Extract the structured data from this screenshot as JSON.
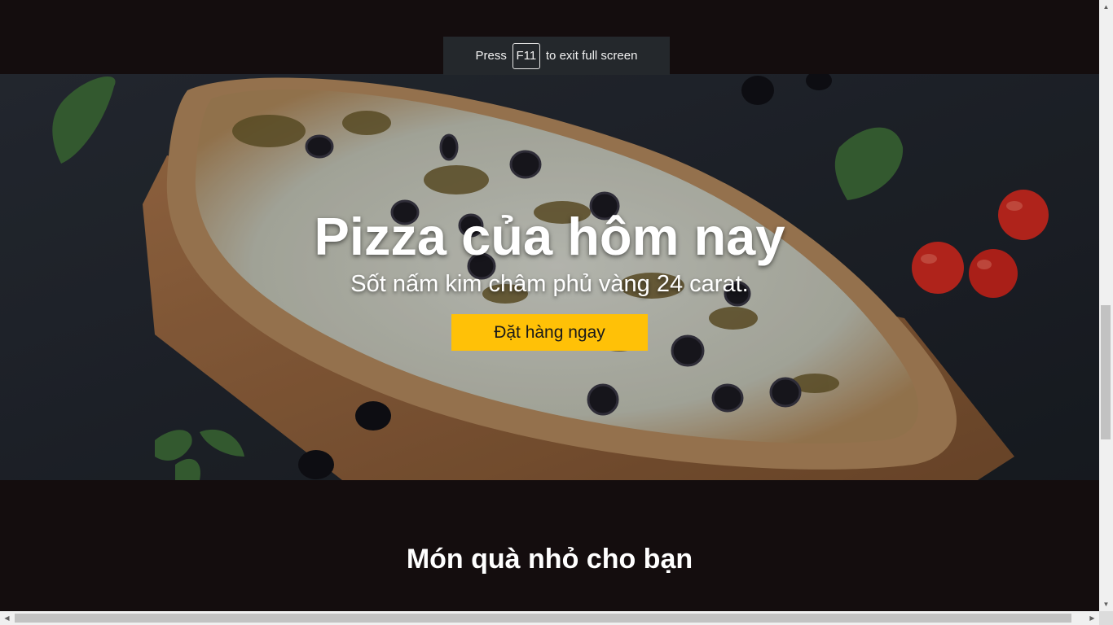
{
  "fullscreen_toast": {
    "prefix": "Press",
    "key": "F11",
    "suffix": "to exit full screen"
  },
  "hero": {
    "title": "Pizza của hôm nay",
    "subtitle": "Sốt nấm kim châm phủ vàng 24 carat.",
    "cta_label": "Đặt hàng ngay",
    "image_icon": "pizza-photo",
    "cta_color": "#ffc107"
  },
  "section": {
    "title": "Món quà nhỏ cho bạn"
  },
  "scrollbars": {
    "up_icon": "▲",
    "down_icon": "▼",
    "left_icon": "◀",
    "right_icon": "▶"
  },
  "colors": {
    "page_background": "#140d0e",
    "toast_background": "#24282c",
    "button_accent": "#ffc107"
  }
}
